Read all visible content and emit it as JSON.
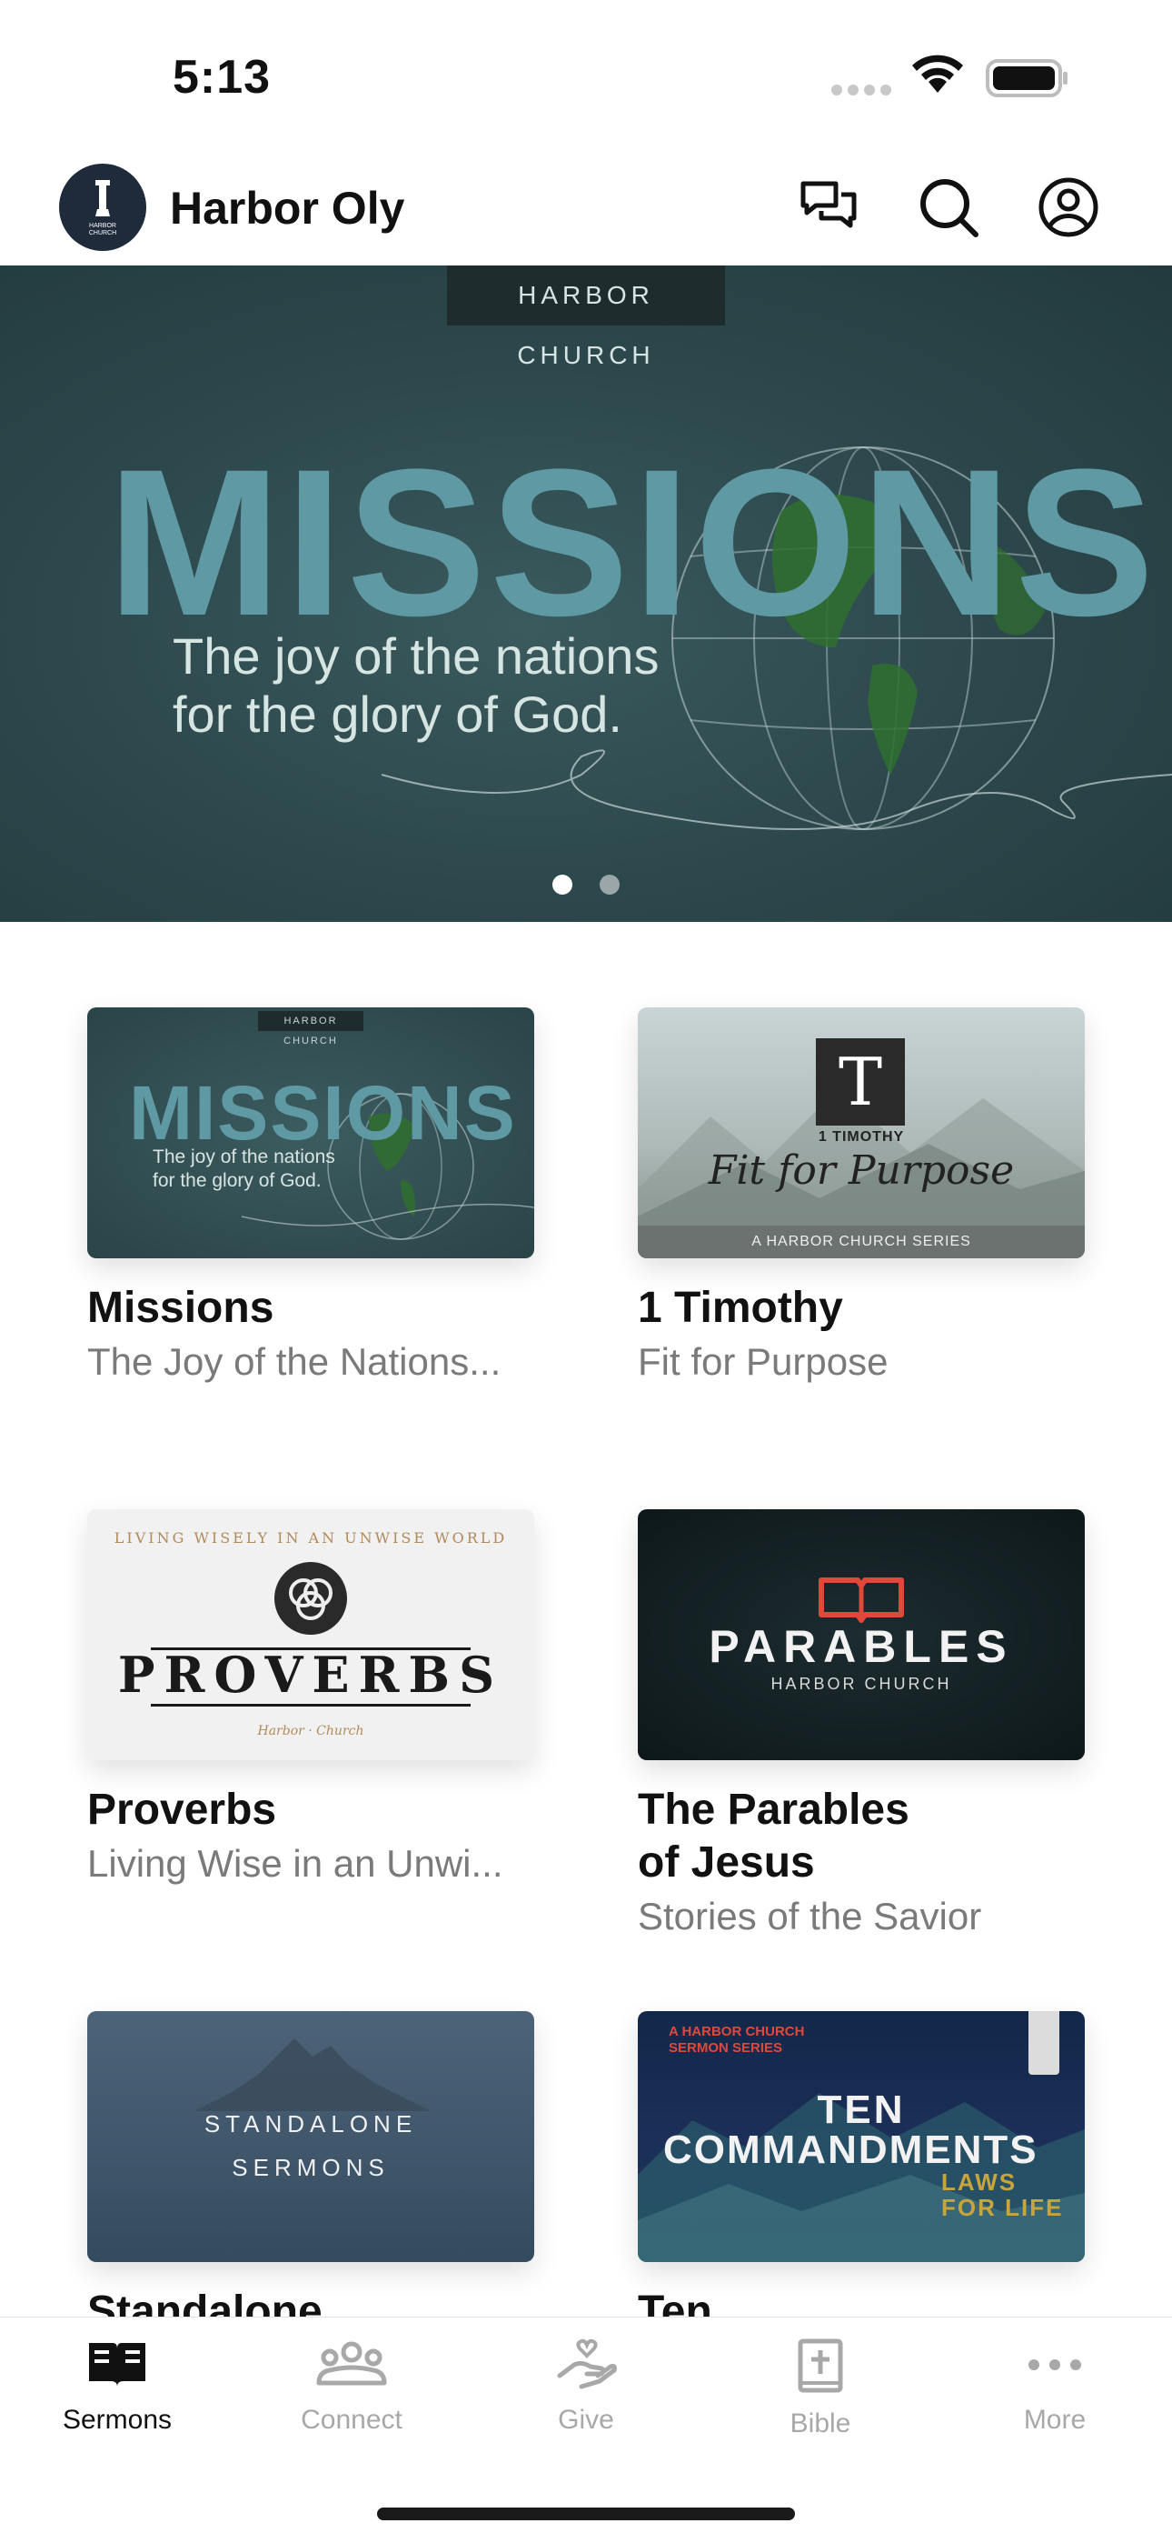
{
  "status_bar": {
    "time": "5:13"
  },
  "header": {
    "app_title": "Harbor Oly",
    "avatar_label": "HARBOR CHURCH"
  },
  "hero": {
    "tag": "HARBOR CHURCH",
    "title": "MISSIONS",
    "subtitle_line1": "The joy of the nations",
    "subtitle_line2": "for the glory of God.",
    "pager": {
      "count": 2,
      "active": 1
    }
  },
  "cards": [
    {
      "title": "Missions",
      "subtitle": "The Joy of the Nations...",
      "art": {
        "tag": "HARBOR CHURCH",
        "title": "MISSIONS",
        "line1": "The joy of the nations",
        "line2": "for the glory of God."
      }
    },
    {
      "title": "1 Timothy",
      "subtitle": "Fit for Purpose",
      "art": {
        "letter": "T",
        "caption": "1 TIMOTHY",
        "script": "Fit for Purpose",
        "band": "A HARBOR CHURCH SERIES"
      }
    },
    {
      "title": "Proverbs",
      "subtitle": "Living Wise in an Unwi...",
      "art": {
        "arc": "LIVING WISELY IN AN UNWISE WORLD",
        "title": "PROVERBS",
        "footer": "Harbor  ·  Church"
      }
    },
    {
      "title": "The Parables\nof Jesus",
      "subtitle": "Stories of the Savior",
      "art": {
        "title": "PARABLES",
        "caption": "HARBOR CHURCH"
      }
    },
    {
      "title": "Standalone",
      "subtitle": "",
      "art": {
        "line1": "STANDALONE",
        "line2": "SERMONS"
      }
    },
    {
      "title": "Ten",
      "subtitle": "",
      "art": {
        "small1": "A HARBOR CHURCH",
        "small2": "SERMON SERIES",
        "line1": "TEN",
        "line2": "COMMANDMENTS",
        "accent1": "LAWS",
        "accent2": "FOR LIFE"
      }
    }
  ],
  "tabs": [
    {
      "label": "Sermons",
      "icon": "open-book-icon",
      "active": true
    },
    {
      "label": "Connect",
      "icon": "people-group-icon",
      "active": false
    },
    {
      "label": "Give",
      "icon": "hand-heart-icon",
      "active": false
    },
    {
      "label": "Bible",
      "icon": "bible-cross-icon",
      "active": false
    },
    {
      "label": "More",
      "icon": "ellipsis-icon",
      "active": false
    }
  ],
  "colors": {
    "accent_teal": "#5f9aa4",
    "tab_active": "#111111",
    "tab_inactive": "#a8a8a8",
    "red_accent": "#e0483a"
  }
}
